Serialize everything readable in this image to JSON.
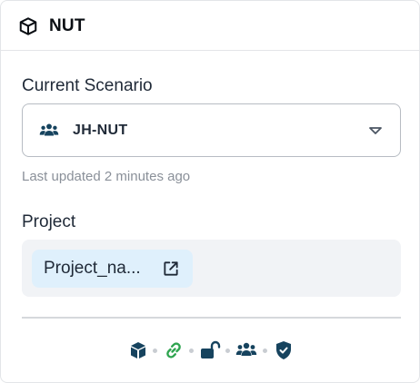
{
  "header": {
    "title": "NUT",
    "icon": "cube-icon"
  },
  "scenario": {
    "label": "Current Scenario",
    "selected": "JH-NUT",
    "icon": "users-icon",
    "last_updated": "Last updated 2 minutes ago"
  },
  "project": {
    "label": "Project",
    "name": "Project_na...",
    "link_icon": "external-link-icon"
  },
  "status_icons": [
    {
      "name": "cube-icon",
      "color": "#16435e"
    },
    {
      "name": "link-icon",
      "color": "#2ea44f"
    },
    {
      "name": "unlock-icon",
      "color": "#16435e"
    },
    {
      "name": "users-icon",
      "color": "#16435e"
    },
    {
      "name": "shield-check-icon",
      "color": "#16435e"
    }
  ],
  "colors": {
    "accent": "#16435e",
    "link_green": "#2ea44f",
    "chip_bg": "#dff0fc",
    "project_bg": "#f1f3f6"
  }
}
